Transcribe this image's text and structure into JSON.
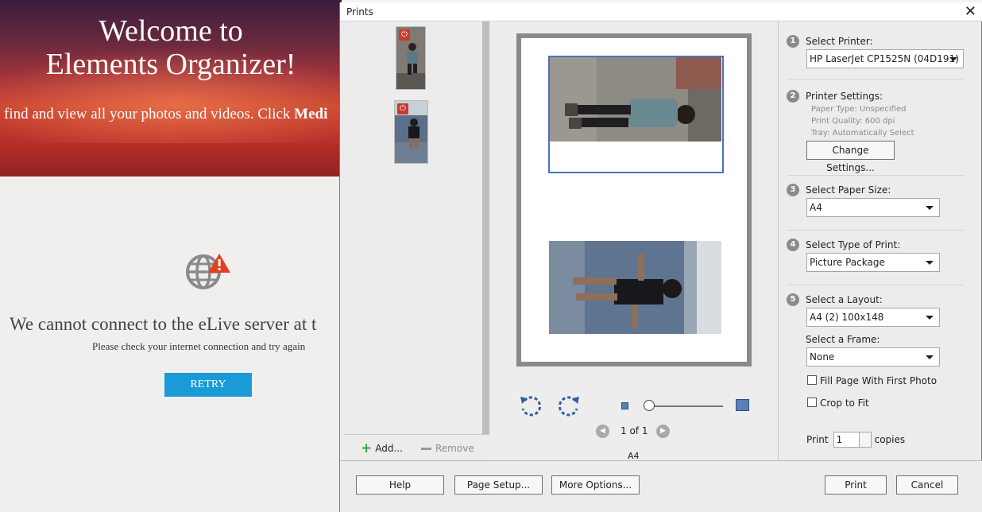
{
  "background_app": {
    "welcome_line1": "Welcome to",
    "welcome_line2": "Elements Organizer!",
    "find_text": "find and view all your photos and videos. Click ",
    "find_bold": "Medi",
    "error_message": "We cannot connect to the eLive server at t",
    "error_hint": "Please check your internet connection and try again",
    "retry_label": "RETRY",
    "globe_icon": "globe-warning-icon"
  },
  "dialog": {
    "title": "Prints",
    "close_glyph": "✕",
    "thumbnails": [
      {
        "name": "photo-boy-running-jacket",
        "badge": "rotate-icon"
      },
      {
        "name": "photo-boy-beach",
        "badge": "rotate-icon"
      }
    ],
    "add_label": "Add...",
    "remove_label": "Remove",
    "preview": {
      "page_indicator": "1 of 1",
      "paper_label": "A4",
      "zoom_level": 0.0
    },
    "settings": {
      "step1_num": "1",
      "select_printer_label": "Select Printer:",
      "printer_value": "HP LaserJet CP1525N (04D191)",
      "step2_num": "2",
      "printer_settings_label": "Printer Settings:",
      "paper_type": "Paper Type: Unspecified",
      "print_quality": "Print Quality: 600 dpi",
      "tray": "Tray:  Automatically Select",
      "change_settings_label": "Change Settings...",
      "step3_num": "3",
      "paper_size_label": "Select Paper Size:",
      "paper_size_value": "A4",
      "step4_num": "4",
      "print_type_label": "Select Type of Print:",
      "print_type_value": "Picture Package",
      "step5_num": "5",
      "layout_label": "Select a Layout:",
      "layout_value": "A4 (2) 100x148",
      "frame_label": "Select a Frame:",
      "frame_value": "None",
      "fill_page_label": "Fill Page With First Photo",
      "fill_page_checked": false,
      "crop_label": "Crop to Fit",
      "crop_checked": false,
      "print_label": "Print",
      "copies_value": "1",
      "copies_label": "copies"
    },
    "buttons": {
      "help": "Help",
      "page_setup": "Page Setup...",
      "more_options": "More Options...",
      "print": "Print",
      "cancel": "Cancel"
    }
  },
  "colors": {
    "accent_blue": "#1a9ad6",
    "warning_red": "#e0401e",
    "selection_blue": "#4a72c2"
  }
}
